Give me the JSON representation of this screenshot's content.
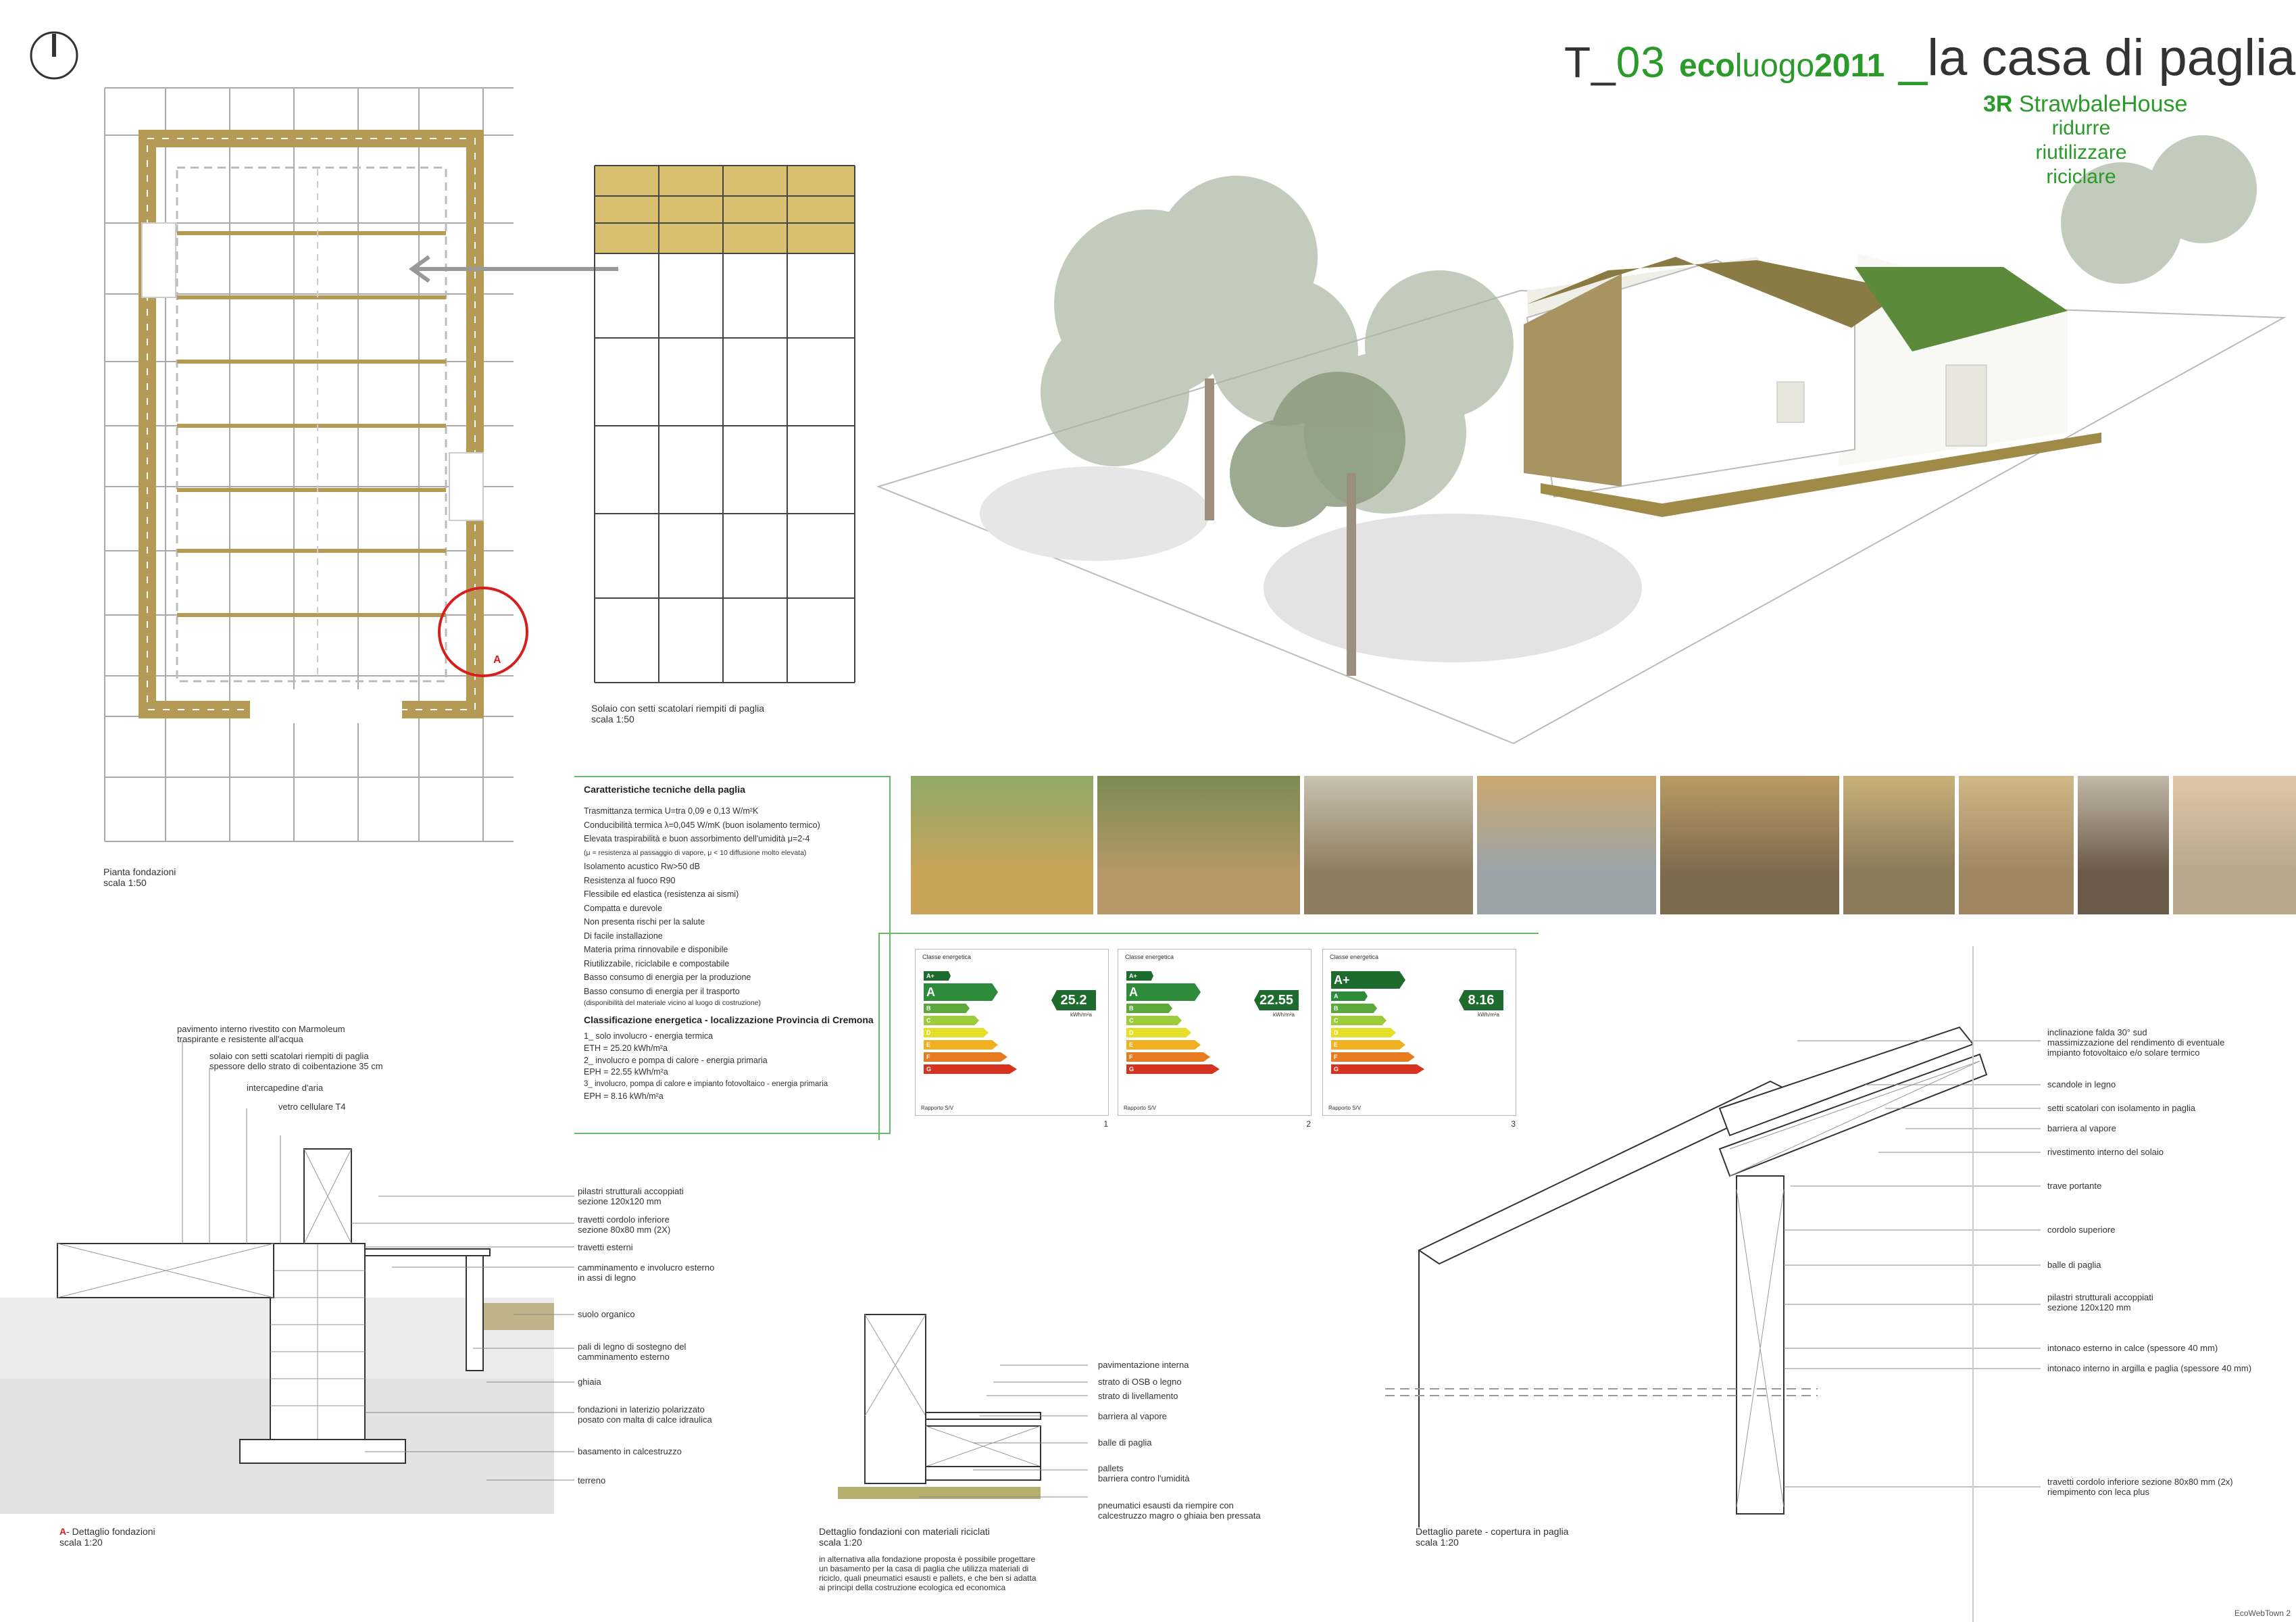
{
  "header": {
    "code_prefix": "T_",
    "code_num": "03",
    "eco_a": "eco",
    "eco_b": "luogo",
    "eco_c": "2011",
    "title_sep": "_",
    "title": "la casa di paglia",
    "sub_3r": "3R",
    "sub_name": "StrawbaleHouse",
    "verbs": [
      "ridurre",
      "riutilizzare",
      "riciclare"
    ]
  },
  "plans": {
    "foundation_caption": [
      "Pianta fondazioni",
      "scala 1:50"
    ],
    "floor_caption": [
      "Solaio con setti scatolari riempiti di paglia",
      "scala 1:50"
    ],
    "detail_marker": "A"
  },
  "specs": {
    "heading": "Caratteristiche tecniche della paglia",
    "lines": [
      "Trasmittanza termica  U=tra 0,09 e 0,13 W/m²K",
      "Conducibilità termica  λ=0,045 W/mK (buon isolamento termico)",
      "Elevata traspirabilità e buon assorbimento dell'umidità  μ=2-4",
      "(μ = resistenza al passaggio di vapore, μ < 10 diffusione molto elevata)",
      "Isolamento acustico  Rw>50 dB",
      "Resistenza al fuoco  R90",
      "Flessibile ed elastica (resistenza ai sismi)",
      "Compatta e durevole",
      "Non presenta rischi per la salute",
      "Di facile installazione",
      "Materia prima rinnovabile e disponibile",
      "Riutilizzabile, riciclabile e compostabile",
      "Basso consumo di energia per la produzione",
      "Basso consumo di energia per il trasporto",
      "(disponibilità del materiale vicino al luogo di costruzione)"
    ],
    "class_heading": "Classificazione energetica - localizzazione Provincia di Cremona",
    "class_lines": [
      "1_ solo involucro - energia termica",
      "ETH = 25.20 kWh/m²a",
      "2_ involucro e pompa di calore - energia primaria",
      "EPH = 22.55 kWh/m²a",
      "3_ involucro, pompa di calore e impianto fotovoltaico - energia primaria",
      "EPH = 8.16 kWh/m²a"
    ]
  },
  "energy": {
    "card_title": "Classe energetica",
    "unit": "kWh/m²a",
    "foot": "Rapporto S/V",
    "cards": [
      {
        "num": "1",
        "cls": "A",
        "value": "25.2"
      },
      {
        "num": "2",
        "cls": "A",
        "value": "22.55"
      },
      {
        "num": "3",
        "cls": "A+",
        "value": "8.16"
      }
    ],
    "grades": [
      "A+",
      "A",
      "B",
      "C",
      "D",
      "E",
      "F",
      "G"
    ],
    "colors": {
      "A+": "#1d6b2d",
      "A": "#2d8b3a",
      "B": "#5aa93a",
      "C": "#9ccc3a",
      "D": "#e6df2a",
      "E": "#f0b020",
      "F": "#e87a1f",
      "G": "#d8321e"
    }
  },
  "photos": [
    "straw-field",
    "straw-bales",
    "timber-frame",
    "frame-structure",
    "frame-corner",
    "bale-wall",
    "window-opening",
    "plastered-window",
    "plastering-hand"
  ],
  "foundation_detail": {
    "labels_left": [
      "pavimento interno rivestito con Marmoleum",
      "traspirante e resistente all'acqua",
      "solaio con setti scatolari riempiti di paglia",
      "spessore dello strato di coibentazione 35 cm",
      "intercapedine d'aria",
      "vetro cellulare T4"
    ],
    "labels_right": [
      "pilastri strutturali accoppiati",
      "sezione 120x120 mm",
      "travetti cordolo inferiore",
      "sezione 80x80 mm (2X)",
      "travetti esterni",
      "camminamento e involucro esterno",
      "in assi di legno",
      "suolo organico",
      "pali di legno di sostegno del",
      "camminamento esterno",
      "ghiaia",
      "fondazioni in laterizio polarizzato",
      "posato con malta di calce idraulica",
      "basamento in calcestruzzo",
      "terreno"
    ],
    "caption_a": "A",
    "caption": "- Dettaglio fondazioni",
    "scale": "scala 1:20"
  },
  "recycled_detail": {
    "labels": [
      "pavimentazione interna",
      "strato di OSB o legno",
      "strato di livellamento",
      "barriera al vapore",
      "balle di paglia",
      "pallets",
      "barriera contro l'umidità",
      "pneumatici esausti da riempire con",
      "calcestruzzo magro o ghiaia ben pressata"
    ],
    "caption": "Dettaglio fondazioni con materiali riciclati",
    "scale": "scala 1:20",
    "note": [
      "in alternativa alla fondazione proposta è possibile progettare",
      "un basamento per la casa di paglia che utilizza materiali di",
      "riciclo, quali pneumatici esausti e pallets, e che ben si adatta",
      "ai principi della costruzione ecologica ed economica"
    ]
  },
  "wall_detail": {
    "labels": [
      "inclinazione falda 30° sud",
      "massimizzazione del rendimento di eventuale",
      "impianto fotovoltaico e/o solare termico",
      "scandole in legno",
      "setti scatolari con isolamento in paglia",
      "barriera al vapore",
      "rivestimento interno del solaio",
      "trave portante",
      "cordolo superiore",
      "balle di paglia",
      "pilastri strutturali accoppiati",
      "sezione 120x120 mm",
      "intonaco esterno in calce (spessore 40 mm)",
      "intonaco interno in argilla e paglia (spessore 40 mm)",
      "travetti cordolo inferiore sezione 80x80 mm (2x)",
      "riempimento con leca plus"
    ],
    "caption": "Dettaglio parete - copertura in paglia",
    "scale": "scala 1:20"
  },
  "footer": "EcoWebTown 2"
}
